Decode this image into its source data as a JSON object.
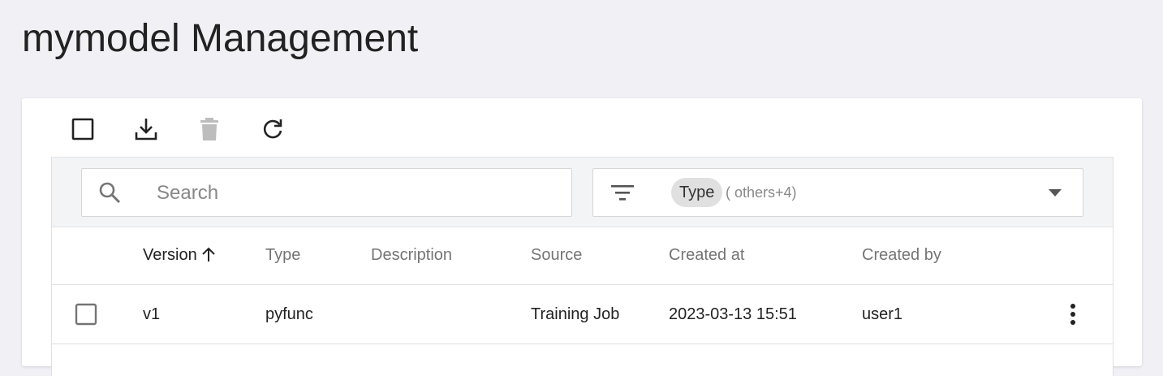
{
  "page": {
    "title": "mymodel Management"
  },
  "toolbar": {
    "icons": [
      "checkbox-icon",
      "download-icon",
      "trash-icon",
      "refresh-icon"
    ],
    "delete_disabled": true
  },
  "search": {
    "placeholder": "Search",
    "value": ""
  },
  "type_filter": {
    "chip_label": "Type",
    "others_label": "( others+4)"
  },
  "table": {
    "columns": {
      "version": "Version",
      "type": "Type",
      "description": "Description",
      "source": "Source",
      "created_at": "Created at",
      "created_by": "Created by"
    },
    "sort": {
      "column": "Version",
      "direction": "ascending"
    },
    "rows": [
      {
        "version": "v1",
        "type": "pyfunc",
        "description": "",
        "source": "Training Job",
        "created_at": "2023-03-13 15:51",
        "created_by": "user1"
      }
    ]
  },
  "colors": {
    "background": "#f0f0f5",
    "card": "#ffffff",
    "filter_bar": "#f3f4f6",
    "chip": "#e0e0e0",
    "disabled_icon": "#bdbdbd"
  }
}
